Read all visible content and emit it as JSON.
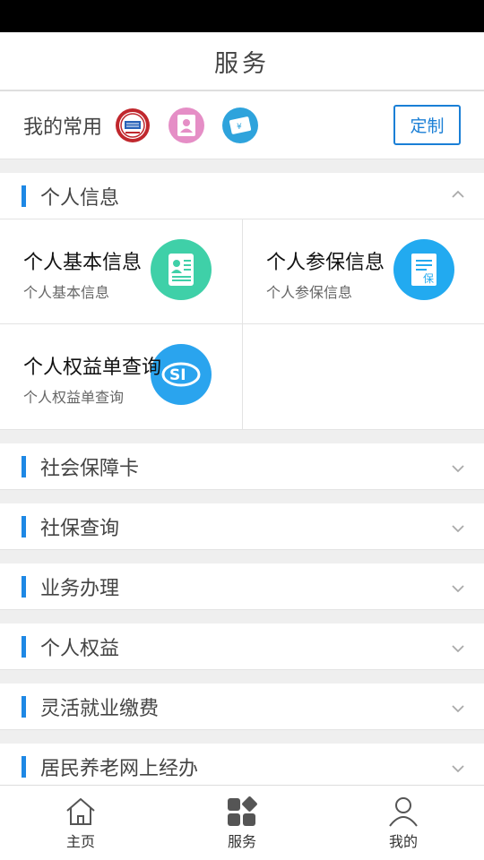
{
  "header": {
    "title": "服务"
  },
  "favorites": {
    "label": "我的常用",
    "customize_label": "定制",
    "shortcuts": [
      {
        "icon": "social-security-seal-icon",
        "color": "#c0272d"
      },
      {
        "icon": "person-id-card-icon",
        "color": "#e58ec6"
      },
      {
        "icon": "yuan-card-icon",
        "color": "#2ea3dc"
      }
    ]
  },
  "sections": [
    {
      "title": "个人信息",
      "expanded": true,
      "items": [
        {
          "title": "个人基本信息",
          "subtitle": "个人基本信息",
          "icon": "id-card-icon",
          "color": "#3fd0a8"
        },
        {
          "title": "个人参保信息",
          "subtitle": "个人参保信息",
          "icon": "insurance-document-icon",
          "color": "#22aaf0"
        },
        {
          "title": "个人权益单查询",
          "subtitle": "个人权益单查询",
          "icon": "si-logo-icon",
          "color": "#2aa4ee"
        }
      ]
    },
    {
      "title": "社会保障卡",
      "expanded": false
    },
    {
      "title": "社保查询",
      "expanded": false
    },
    {
      "title": "业务办理",
      "expanded": false
    },
    {
      "title": "个人权益",
      "expanded": false
    },
    {
      "title": "灵活就业缴费",
      "expanded": false
    },
    {
      "title": "居民养老网上经办",
      "expanded": false
    }
  ],
  "tabbar": {
    "items": [
      {
        "label": "主页",
        "icon": "home-icon"
      },
      {
        "label": "服务",
        "icon": "services-grid-icon"
      },
      {
        "label": "我的",
        "icon": "person-icon"
      }
    ]
  }
}
